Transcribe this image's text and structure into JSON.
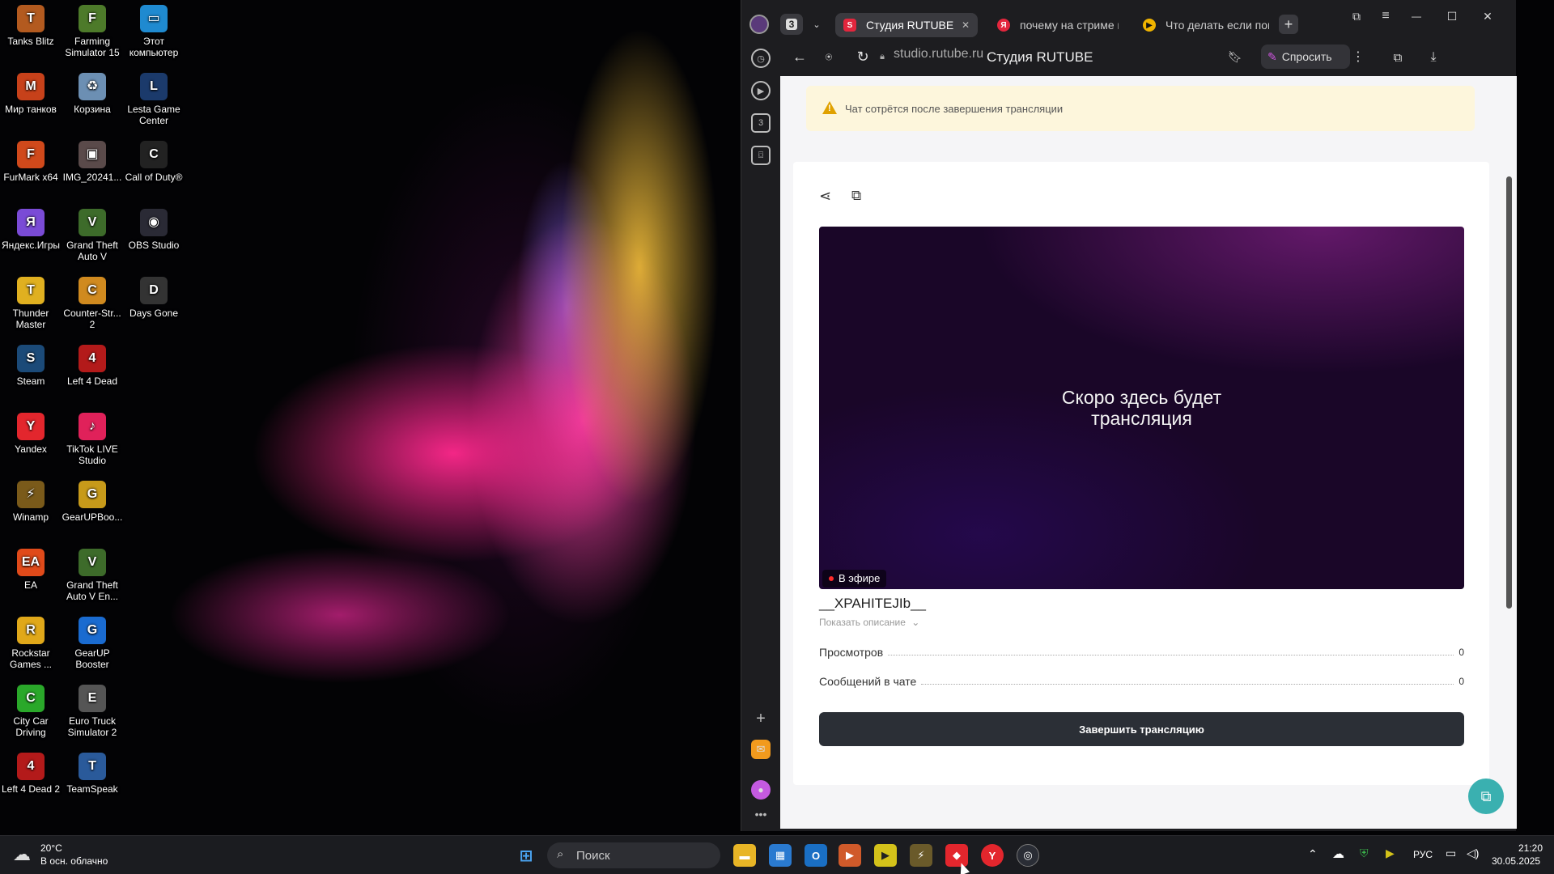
{
  "desktop": {
    "icons": [
      {
        "label": "Tanks Blitz",
        "glyph": "T",
        "color": "#b35a1f"
      },
      {
        "label": "Farming Simulator 15",
        "glyph": "F",
        "color": "#4d7a2a"
      },
      {
        "label": "Этот компьютер",
        "glyph": "▭",
        "color": "#1f8ad0"
      },
      {
        "label": "Мир танков",
        "glyph": "M",
        "color": "#c7411a"
      },
      {
        "label": "Корзина",
        "glyph": "♻",
        "color": "#6c8fb3"
      },
      {
        "label": "Lesta Game Center",
        "glyph": "L",
        "color": "#1b3a6b"
      },
      {
        "label": "FurMark x64",
        "glyph": "F",
        "color": "#d0491b"
      },
      {
        "label": "IMG_20241...",
        "glyph": "▣",
        "color": "#5a4a4a"
      },
      {
        "label": "Call of Duty®",
        "glyph": "C",
        "color": "#222"
      },
      {
        "label": "Яндекс.Игры",
        "glyph": "Я",
        "color": "#7a4bd6"
      },
      {
        "label": "Grand Theft Auto V",
        "glyph": "V",
        "color": "#3d6b2a"
      },
      {
        "label": "OBS Studio",
        "glyph": "◉",
        "color": "#2a2a35"
      },
      {
        "label": "Thunder Master",
        "glyph": "T",
        "color": "#e0b020"
      },
      {
        "label": "Counter-Str... 2",
        "glyph": "C",
        "color": "#d08a1f"
      },
      {
        "label": "Days Gone",
        "glyph": "D",
        "color": "#333"
      },
      {
        "label": "Steam",
        "glyph": "S",
        "color": "#1b4a78"
      },
      {
        "label": "Left 4 Dead",
        "glyph": "4",
        "color": "#b31a1a"
      },
      {
        "label": "Yandex",
        "glyph": "Y",
        "color": "#e3262d"
      },
      {
        "label": "TikTok LIVE Studio",
        "glyph": "♪",
        "color": "#e0215a"
      },
      {
        "label": "Winamp",
        "glyph": "⚡",
        "color": "#7a5a1a"
      },
      {
        "label": "GearUPBoo...",
        "glyph": "G",
        "color": "#c79a1a"
      },
      {
        "label": "EA",
        "glyph": "EA",
        "color": "#e04a1a"
      },
      {
        "label": "Grand Theft Auto V En...",
        "glyph": "V",
        "color": "#3d6b2a"
      },
      {
        "label": "Rockstar Games ...",
        "glyph": "R",
        "color": "#e0a81a"
      },
      {
        "label": "GearUP Booster",
        "glyph": "G",
        "color": "#1a6bd0"
      },
      {
        "label": "City Car Driving",
        "glyph": "C",
        "color": "#2aa82a"
      },
      {
        "label": "Euro Truck Simulator 2",
        "glyph": "E",
        "color": "#555"
      },
      {
        "label": "Left 4 Dead 2",
        "glyph": "4",
        "color": "#b31a1a"
      },
      {
        "label": "TeamSpeak",
        "glyph": "T",
        "color": "#2a5a9a"
      }
    ]
  },
  "browser": {
    "tab_count": "3",
    "tabs": [
      {
        "label": "Студия RUTUBE",
        "fav_glyph": "S",
        "fav_color": "#e3263d"
      },
      {
        "label": "почему на стриме по...",
        "fav_glyph": "Я",
        "fav_color": "#e3263d"
      },
      {
        "label": "Что делать если повт...",
        "fav_glyph": "▶",
        "fav_color": "#f0b400"
      }
    ],
    "address": {
      "domain": "studio.rutube.ru",
      "page_title": "Студия RUTUBE"
    },
    "ask_button": "Спросить",
    "sidebar_badge": "3",
    "window_controls": {
      "minimize": "—",
      "maximize": "☐",
      "close": "✕"
    }
  },
  "page": {
    "warning_text": "Чат сотрётся после завершения трансляции",
    "player_message_line1": "Скоро здесь будет",
    "player_message_line2": "трансляция",
    "live_badge": "В эфире",
    "stream_title": "__XPAHITEJIb__",
    "show_description": "Показать описание",
    "stats": [
      {
        "label": "Просмотров",
        "value": "0"
      },
      {
        "label": "Сообщений в чате",
        "value": "0"
      }
    ],
    "end_stream_button": "Завершить трансляцию"
  },
  "taskbar": {
    "weather_temp": "20°C",
    "weather_desc": "В осн. облачно",
    "search_placeholder": "Поиск",
    "language": "РУС",
    "time": "21:20",
    "date": "30.05.2025"
  }
}
